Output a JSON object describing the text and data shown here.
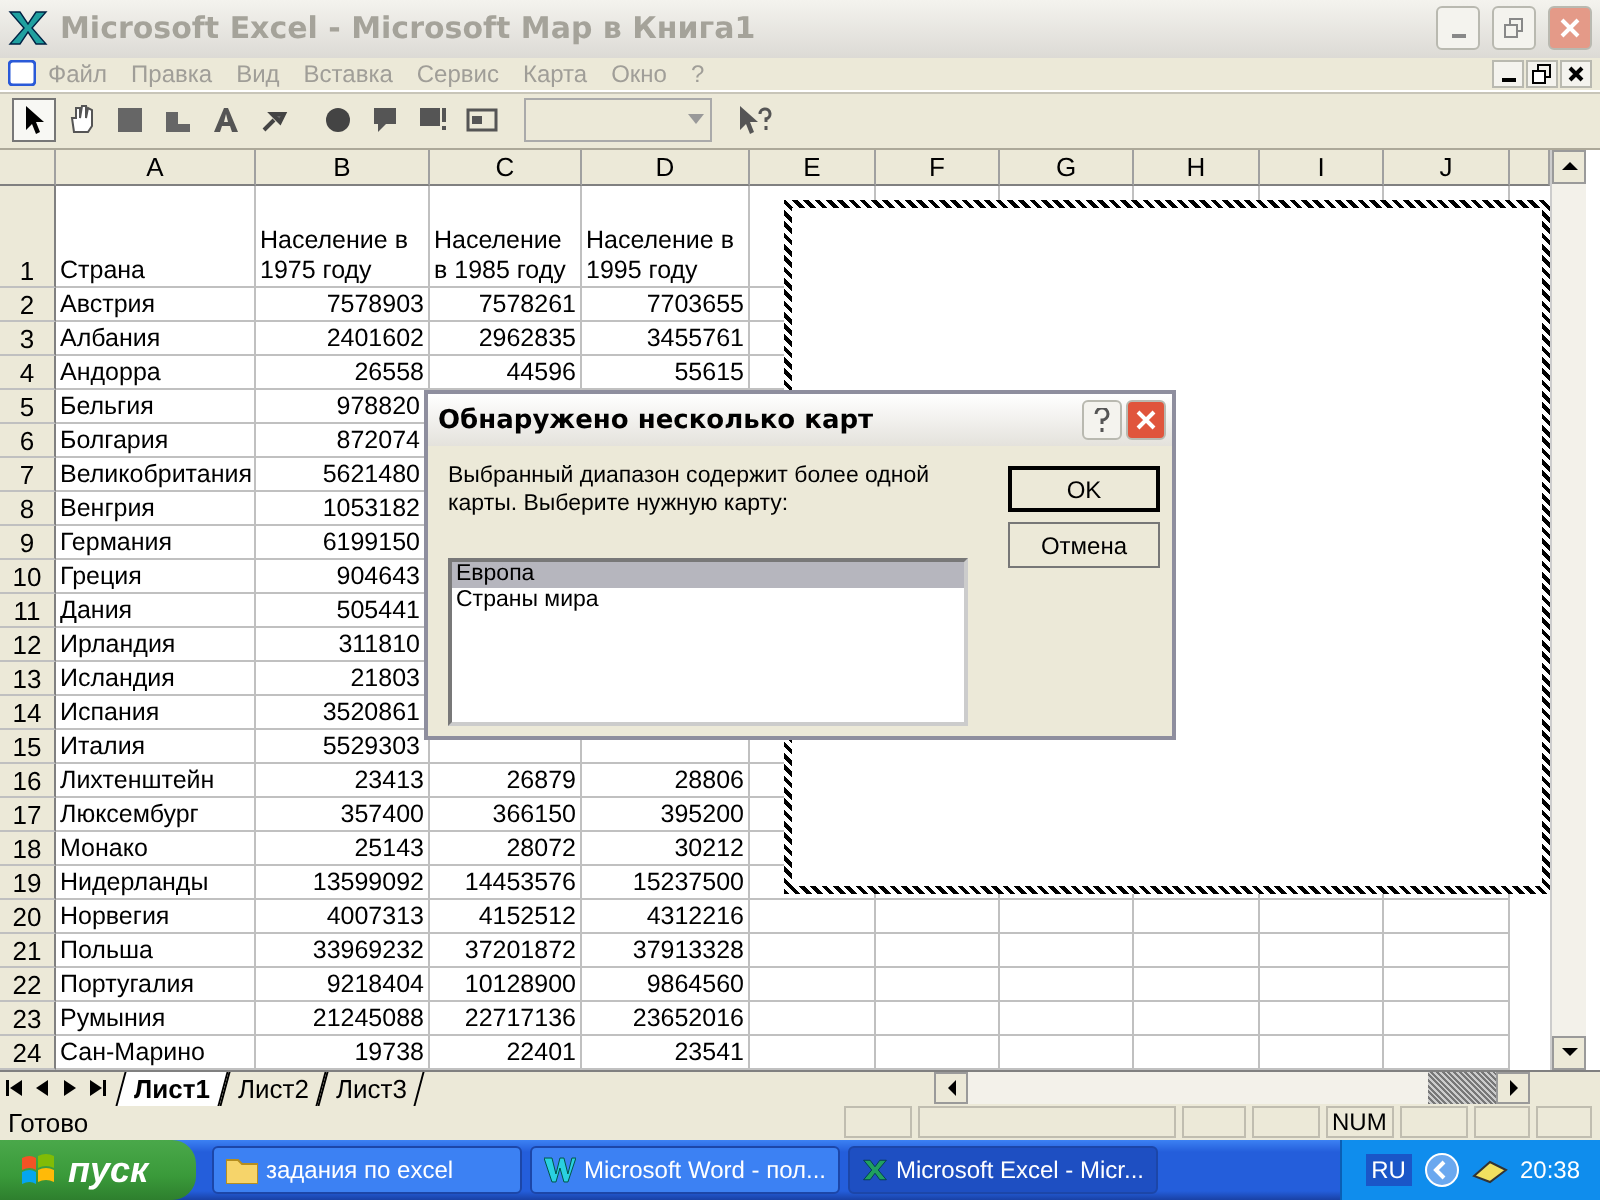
{
  "window": {
    "title": "Microsoft Excel - Microsoft Map в Книга1"
  },
  "menu": [
    "Файл",
    "Правка",
    "Вид",
    "Вставка",
    "Сервис",
    "Карта",
    "Окно",
    "?"
  ],
  "columns": [
    "A",
    "B",
    "C",
    "D",
    "E",
    "F",
    "G",
    "H",
    "I",
    "J"
  ],
  "header_row": {
    "number": "1",
    "cells": [
      "Страна",
      "Население в 1975 году",
      "Население в 1985 году",
      "Население в 1995 году"
    ]
  },
  "rows": [
    {
      "number": "2",
      "country": "Австрия",
      "pop_1975": "7578903",
      "pop_1985": "7578261",
      "pop_1995": "7703655"
    },
    {
      "number": "3",
      "country": "Албания",
      "pop_1975": "2401602",
      "pop_1985": "2962835",
      "pop_1995": "3455761"
    },
    {
      "number": "4",
      "country": "Андорра",
      "pop_1975": "26558",
      "pop_1985": "44596",
      "pop_1995": "55615"
    },
    {
      "number": "5",
      "country": "Бельгия",
      "pop_1975": "978820"
    },
    {
      "number": "6",
      "country": "Болгария",
      "pop_1975": "872074"
    },
    {
      "number": "7",
      "country": "Великобритания",
      "pop_1975": "5621480"
    },
    {
      "number": "8",
      "country": "Венгрия",
      "pop_1975": "1053182"
    },
    {
      "number": "9",
      "country": "Германия",
      "pop_1975": "6199150"
    },
    {
      "number": "10",
      "country": "Греция",
      "pop_1975": "904643"
    },
    {
      "number": "11",
      "country": "Дания",
      "pop_1975": "505441"
    },
    {
      "number": "12",
      "country": "Ирландия",
      "pop_1975": "311810"
    },
    {
      "number": "13",
      "country": "Исландия",
      "pop_1975": "21803"
    },
    {
      "number": "14",
      "country": "Испания",
      "pop_1975": "3520861"
    },
    {
      "number": "15",
      "country": "Италия",
      "pop_1975": "5529303"
    },
    {
      "number": "16",
      "country": "Лихтенштейн",
      "pop_1975": "23413",
      "pop_1985": "26879",
      "pop_1995": "28806"
    },
    {
      "number": "17",
      "country": "Люксембург",
      "pop_1975": "357400",
      "pop_1985": "366150",
      "pop_1995": "395200"
    },
    {
      "number": "18",
      "country": "Монако",
      "pop_1975": "25143",
      "pop_1985": "28072",
      "pop_1995": "30212"
    },
    {
      "number": "19",
      "country": "Нидерланды",
      "pop_1975": "13599092",
      "pop_1985": "14453576",
      "pop_1995": "15237500"
    },
    {
      "number": "20",
      "country": "Норвегия",
      "pop_1975": "4007313",
      "pop_1985": "4152512",
      "pop_1995": "4312216"
    },
    {
      "number": "21",
      "country": "Польша",
      "pop_1975": "33969232",
      "pop_1985": "37201872",
      "pop_1995": "37913328"
    },
    {
      "number": "22",
      "country": "Португалия",
      "pop_1975": "9218404",
      "pop_1985": "10128900",
      "pop_1995": "9864560"
    },
    {
      "number": "23",
      "country": "Румыния",
      "pop_1975": "21245088",
      "pop_1985": "22717136",
      "pop_1995": "23652016"
    },
    {
      "number": "24",
      "country": "Сан-Марино",
      "pop_1975": "19738",
      "pop_1985": "22401",
      "pop_1995": "23541"
    }
  ],
  "sheet_tabs": [
    {
      "label": "Лист1",
      "selected": true
    },
    {
      "label": "Лист2",
      "selected": false
    },
    {
      "label": "Лист3",
      "selected": false
    }
  ],
  "status_bar": {
    "text": "Готово",
    "indicator": "NUM"
  },
  "dialog": {
    "title": "Обнаружено несколько карт",
    "message": "Выбранный диапазон содержит более одной карты. Выберите нужную карту:",
    "maps": [
      {
        "label": "Европа",
        "selected": true
      },
      {
        "label": "Страны мира",
        "selected": false
      }
    ],
    "buttons": [
      {
        "label": "OK",
        "kind": "default"
      },
      {
        "label": "Отмена",
        "kind": "normal"
      }
    ]
  },
  "taskbar": {
    "start": "пуск",
    "tasks": [
      {
        "label": "задания по excel",
        "kind": "folder",
        "selected": false
      },
      {
        "label": "Microsoft Word - пол...",
        "kind": "word",
        "selected": false
      },
      {
        "label": "Microsoft Excel - Micr...",
        "kind": "excel",
        "selected": true
      }
    ],
    "language": "RU",
    "clock": "20:38"
  }
}
